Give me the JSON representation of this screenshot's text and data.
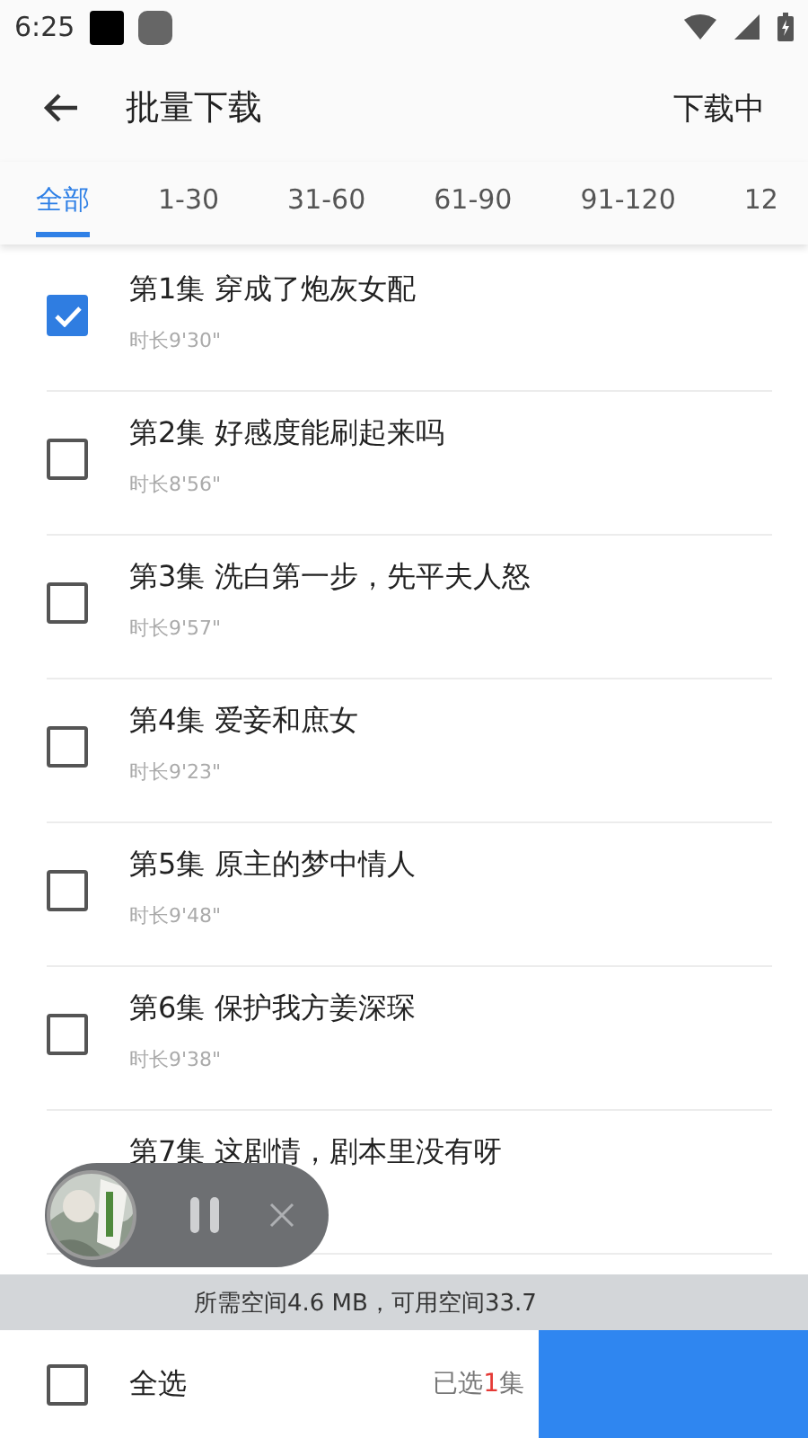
{
  "status_bar": {
    "time": "6:25"
  },
  "app_bar": {
    "title": "批量下载",
    "action": "下载中"
  },
  "tabs": [
    {
      "label": "全部",
      "selected": true
    },
    {
      "label": "1-30",
      "selected": false
    },
    {
      "label": "31-60",
      "selected": false
    },
    {
      "label": "61-90",
      "selected": false
    },
    {
      "label": "91-120",
      "selected": false
    },
    {
      "label": "12",
      "selected": false
    }
  ],
  "episodes": [
    {
      "title": "第1集 穿成了炮灰女配",
      "duration": "时长9'30\"",
      "checked": true
    },
    {
      "title": "第2集 好感度能刷起来吗",
      "duration": "时长8'56\"",
      "checked": false
    },
    {
      "title": "第3集 洗白第一步，先平夫人怒",
      "duration": "时长9'57\"",
      "checked": false
    },
    {
      "title": "第4集 爱妾和庶女",
      "duration": "时长9'23\"",
      "checked": false
    },
    {
      "title": "第5集 原主的梦中情人",
      "duration": "时长9'48\"",
      "checked": false
    },
    {
      "title": "第6集 保护我方姜深琛",
      "duration": "时长9'38\"",
      "checked": false
    },
    {
      "title": "第7集 这剧情，剧本里没有呀"
    }
  ],
  "space_info": "所需空间4.6 MB，可用空间33.7",
  "footer": {
    "select_all": {
      "label": "全选",
      "checked": false
    },
    "selected_prefix": "已选",
    "selected_count": "1",
    "selected_suffix": "集"
  },
  "player": {
    "playing": true
  }
}
